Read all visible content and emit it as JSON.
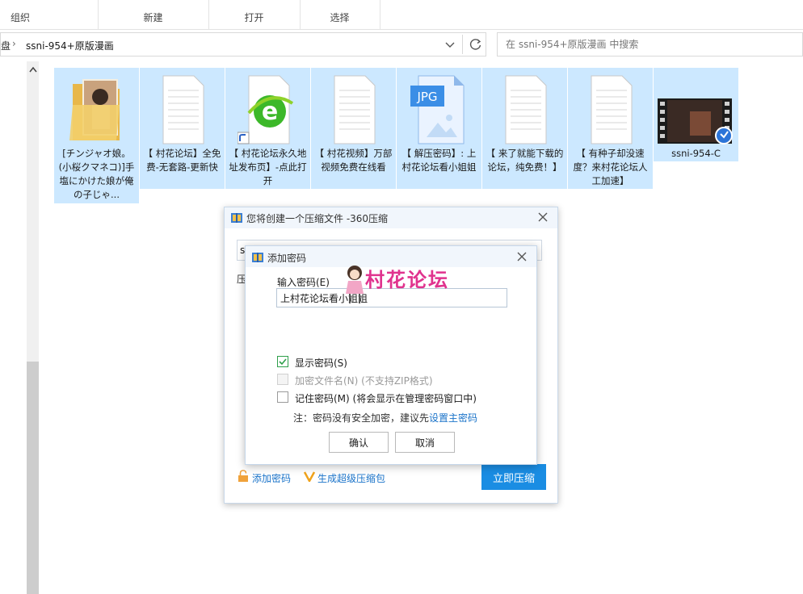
{
  "ribbon": {
    "groups": [
      {
        "label": "组织"
      },
      {
        "label": "新建"
      },
      {
        "label": "打开"
      },
      {
        "label": "选择"
      }
    ]
  },
  "address": {
    "root_fragment": "盘",
    "folder": "ssni-954+原版漫画"
  },
  "search": {
    "placeholder": "在 ssni-954+原版漫画 中搜索"
  },
  "files": [
    {
      "name": "[チンジャオ娘。(小桜クマネコ)]手塩にかけた娘が俺の子じゃ...",
      "icon": "folder-icon",
      "thumb": "folder-thumbnail-image"
    },
    {
      "name": "【 村花论坛】全免费-无套路-更新快",
      "icon": "text-document-icon"
    },
    {
      "name": "【 村花论坛永久地址发布页】-点此打开",
      "icon": "ie-shortcut-icon"
    },
    {
      "name": "【 村花视频】万部视频免费在线看",
      "icon": "text-document-icon"
    },
    {
      "name": "【 解压密码】: 上村花论坛看小姐姐",
      "icon": "jpg-file-icon",
      "badge": "JPG"
    },
    {
      "name": "【 来了就能下载的论坛，纯免费！】",
      "icon": "text-document-icon"
    },
    {
      "name": "【 有种子却没速度？来村花论坛人工加速】",
      "icon": "text-document-icon"
    },
    {
      "name": "ssni-954-C",
      "icon": "video-file-icon"
    }
  ],
  "compress_dialog": {
    "title": "您将创建一个压缩文件 -360压缩",
    "path_fragment": "s",
    "label_fragment": "压",
    "add_password_link": "添加密码",
    "super_pack_link": "生成超级压缩包",
    "compress_button": "立即压缩"
  },
  "password_dialog": {
    "title": "添加密码",
    "input_label": "输入密码(E)",
    "password_value": "上村花论坛看小姐姐",
    "options": [
      {
        "label": "显示密码(S)",
        "checked": true,
        "disabled": false
      },
      {
        "label": "加密文件名(N) (不支持ZIP格式)",
        "checked": false,
        "disabled": true
      },
      {
        "label": "记住密码(M) (将会显示在管理密码窗口中)",
        "checked": false,
        "disabled": false
      }
    ],
    "note_prefix": "注：密码没有安全加密，建议先",
    "note_link": "设置主密码",
    "ok_button": "确认",
    "cancel_button": "取消"
  },
  "watermark": {
    "text": "村花论坛"
  },
  "colors": {
    "selection": "#cce8ff",
    "accent": "#1a8de3",
    "link": "#1a73c9",
    "watermark": "#e0338e"
  }
}
